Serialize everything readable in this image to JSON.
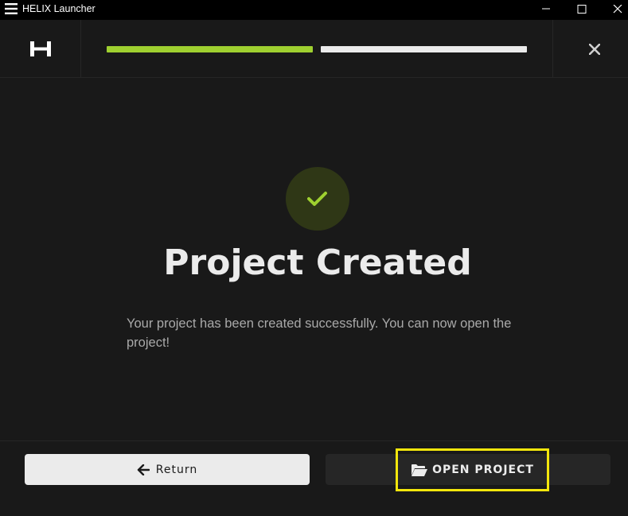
{
  "window": {
    "title": "HELIX Launcher"
  },
  "header": {
    "logo": "H",
    "progress": {
      "completed_steps": 1,
      "total_steps": 2
    },
    "accent_color": "#9fd030"
  },
  "main": {
    "heading": "Project Created",
    "message": "Your project has been created successfully. You can now open the project!"
  },
  "footer": {
    "return_label": "Return",
    "open_label": "OPEN PROJECT"
  },
  "icons": {
    "menu": "hamburger-icon",
    "minimize": "minimize-icon",
    "maximize": "maximize-icon",
    "close_window": "close-icon",
    "close_wizard": "close-x-icon",
    "success": "checkmark-icon",
    "return": "arrow-left-icon",
    "open": "folder-open-icon"
  }
}
